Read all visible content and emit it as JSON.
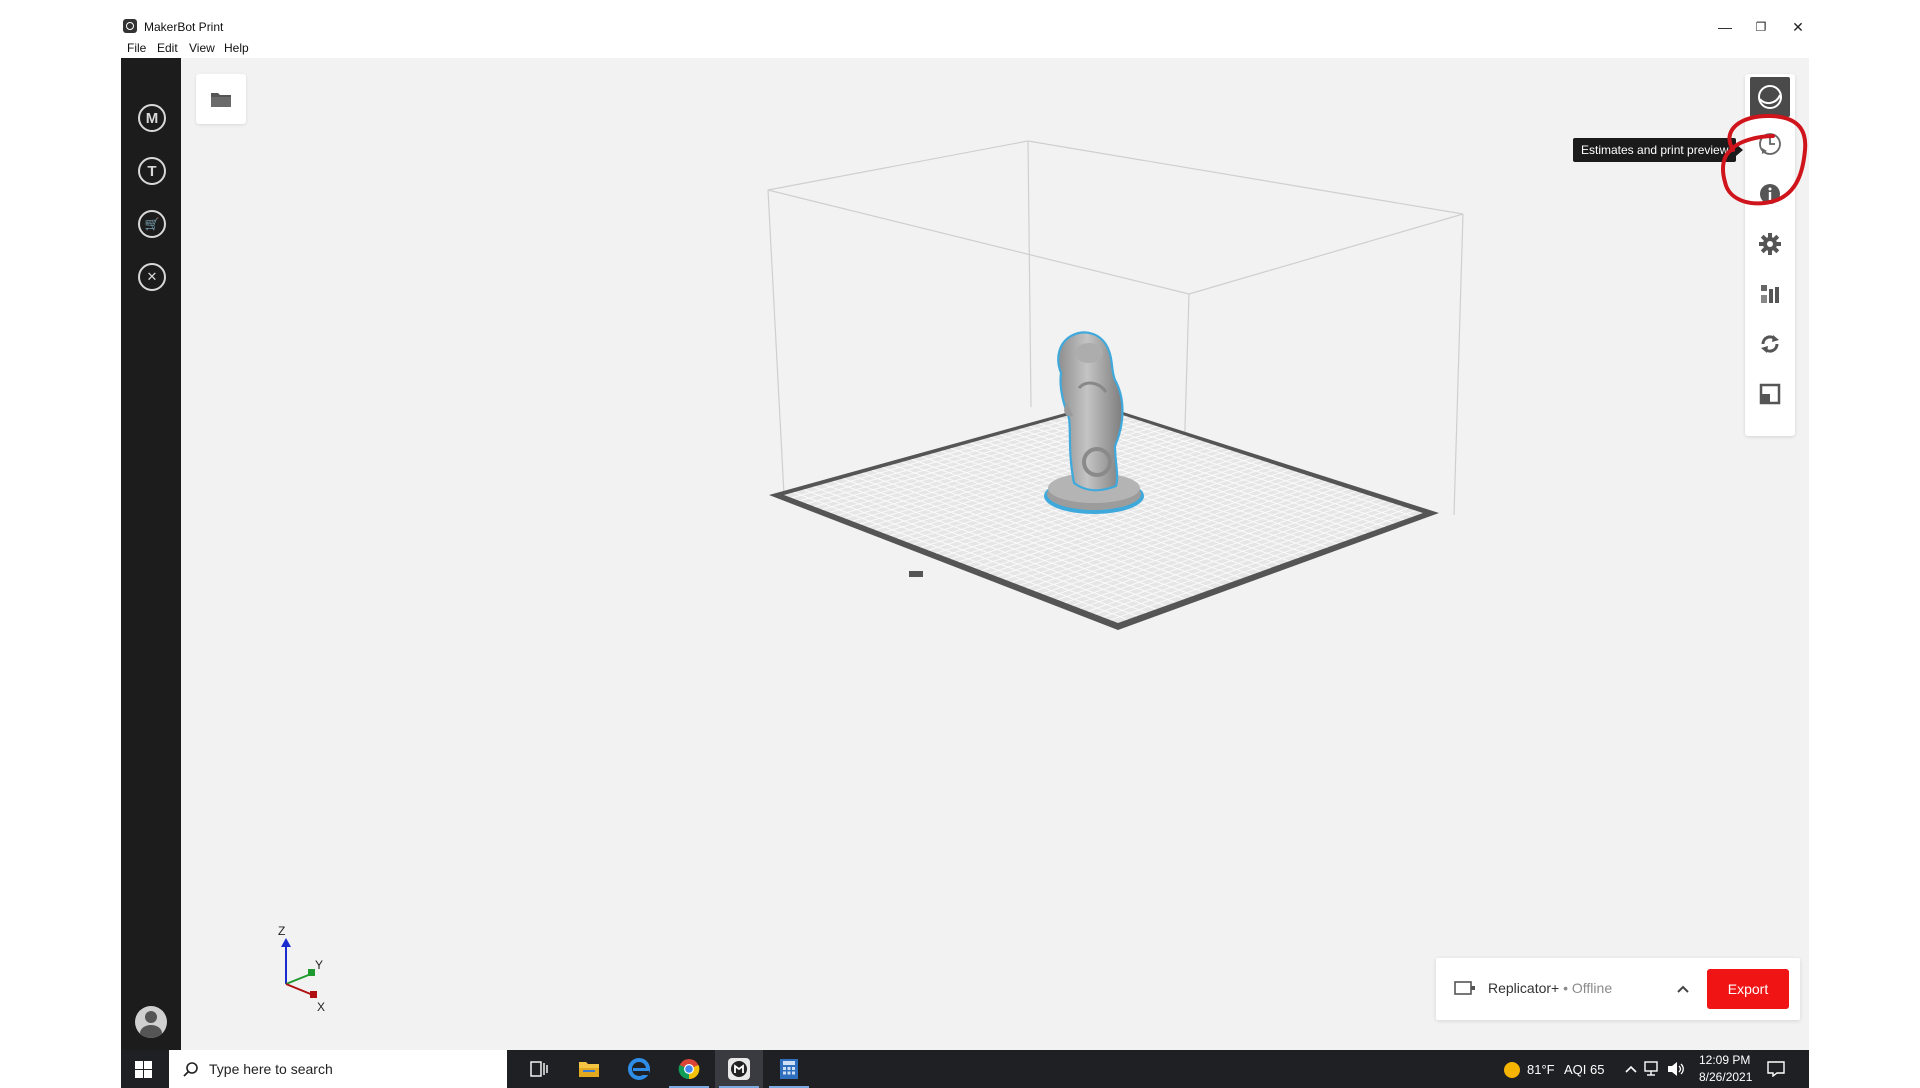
{
  "window": {
    "title": "MakerBot Print",
    "minimize_glyph": "—",
    "restore_glyph": "❐",
    "close_glyph": "✕"
  },
  "menu": [
    "File",
    "Edit",
    "View",
    "Help"
  ],
  "left_sidebar": [
    {
      "name": "makerbot-logo-icon",
      "glyph": "M"
    },
    {
      "name": "thingiverse-icon",
      "glyph": "T"
    },
    {
      "name": "store-cart-icon",
      "glyph": "🛒"
    },
    {
      "name": "tools-icon",
      "glyph": "✕"
    }
  ],
  "right_toolbar": [
    {
      "name": "view-icon",
      "active": true
    },
    {
      "name": "estimates-preview-icon",
      "tooltip": "Estimates and print preview"
    },
    {
      "name": "info-icon"
    },
    {
      "name": "settings-gear-icon"
    },
    {
      "name": "arrange-icon"
    },
    {
      "name": "rotate-icon"
    },
    {
      "name": "scale-icon"
    }
  ],
  "tooltip": "Estimates and print preview",
  "axis": {
    "z": "Z",
    "y": "Y",
    "x": "X"
  },
  "printer": {
    "name": "Replicator+",
    "separator": " • ",
    "status": "Offline"
  },
  "export_label": "Export",
  "colors": {
    "export": "#f01414",
    "selection_outline": "#3fa9dc",
    "annotation": "#d0141c",
    "sidebar": "#1c1c1c"
  },
  "taskbar": {
    "search_placeholder": "Type here to search",
    "weather_temp": "81°F",
    "aqi": "AQI 65",
    "time": "12:09 PM",
    "date": "8/26/2021"
  }
}
